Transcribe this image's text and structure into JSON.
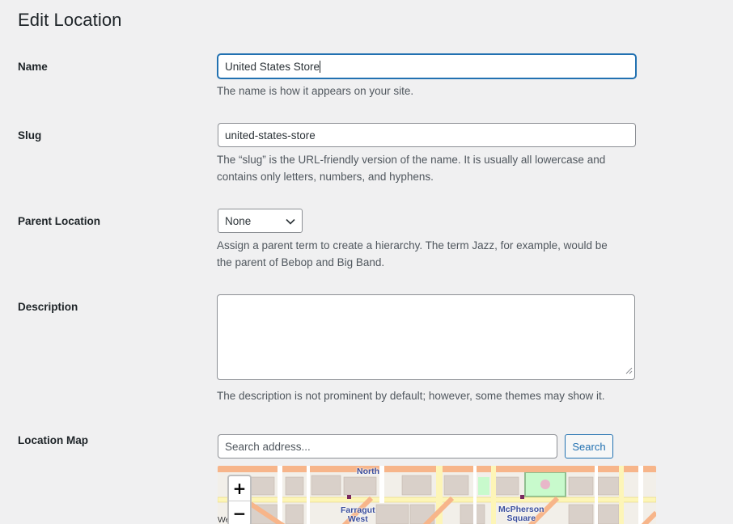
{
  "page": {
    "title": "Edit Location"
  },
  "fields": {
    "name": {
      "label": "Name",
      "value": "United States Store",
      "help": "The name is how it appears on your site."
    },
    "slug": {
      "label": "Slug",
      "value": "united-states-store",
      "help_line1": "The “slug” is the URL-friendly version of the name. It is usually all lowercase and",
      "help_line2": "contains only letters, numbers, and hyphens."
    },
    "parent": {
      "label": "Parent Location",
      "selected": "None",
      "help_line1": "Assign a parent term to create a hierarchy. The term Jazz, for example, would be",
      "help_line2": "the parent of Bebop and Big Band."
    },
    "description": {
      "label": "Description",
      "value": "",
      "help": "The description is not prominent by default; however, some themes may show it."
    },
    "location_map": {
      "label": "Location Map",
      "search_placeholder": "Search address...",
      "search_button": "Search",
      "zoom_in": "+",
      "zoom_out": "−",
      "map_labels": {
        "north": "North",
        "farragut_line1": "Farragut",
        "farragut_line2": "West",
        "mcpherson_line1": "McPherson",
        "mcpherson_line2": "Square",
        "edge_partial": "We"
      }
    }
  },
  "icons": {
    "select_arrow": "chevron-down-icon",
    "textarea_grip": "resize-grip-icon"
  },
  "colors": {
    "accent": "#2271b1",
    "page_bg": "#f0f0f1",
    "map_bg": "#f2efe9",
    "map_road_major": "#f7b58a",
    "map_road_minor": "#ffffff",
    "map_block": "#d9d0c9",
    "map_park": "#c8facc"
  }
}
